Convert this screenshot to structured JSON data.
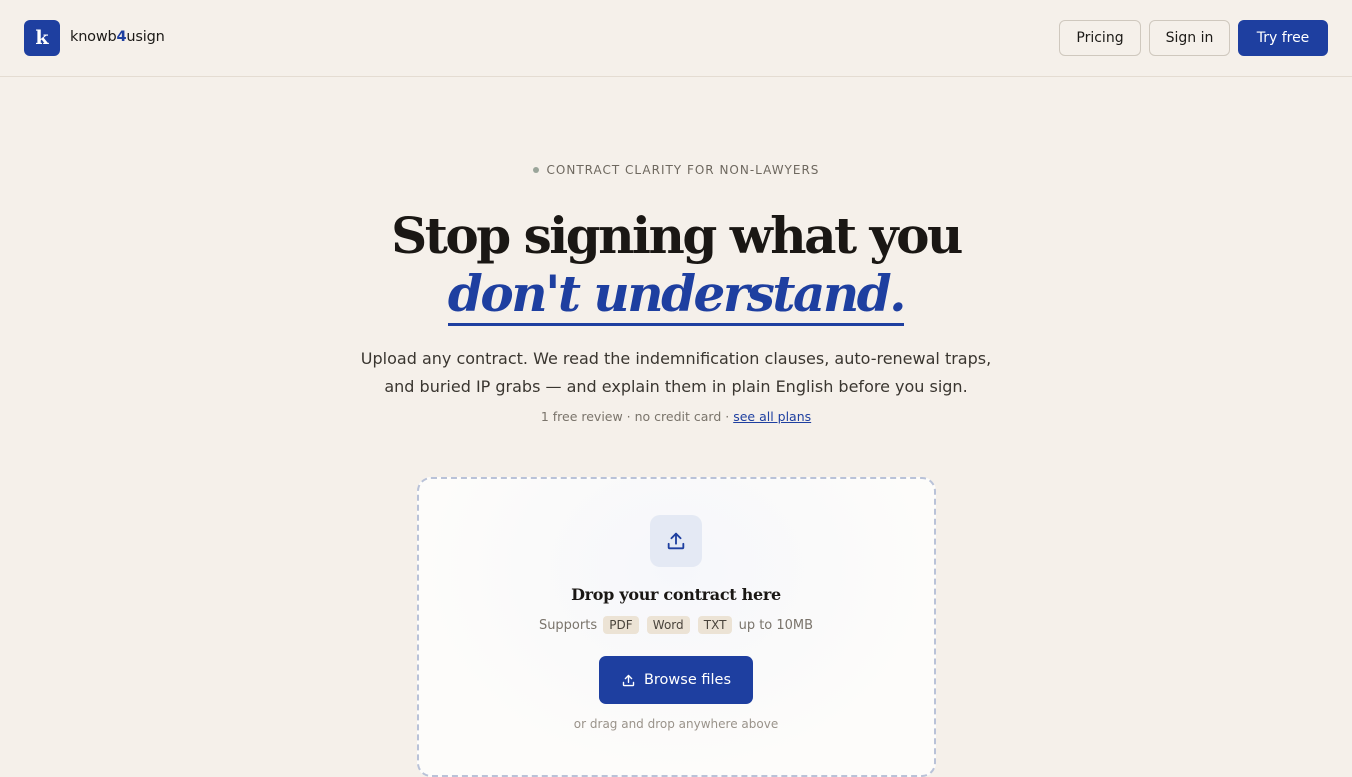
{
  "header": {
    "logo_letter": "k",
    "brand_pre": "knowb",
    "brand_accent": "4",
    "brand_post": "usign",
    "nav": {
      "pricing": "Pricing",
      "sign_in": "Sign in",
      "try_free": "Try free"
    }
  },
  "hero": {
    "eyebrow": "CONTRACT CLARITY FOR NON-LAWYERS",
    "headline_line1": "Stop signing what you",
    "headline_line2": "don't understand.",
    "subtitle": "Upload any contract. We read the indemnification clauses, auto-renewal traps, and buried IP grabs — and explain them in plain English before you sign.",
    "fine_print": "1 free review · no credit card · ",
    "plans_link": "see all plans"
  },
  "dropzone": {
    "icon": "upload-icon",
    "title": "Drop your contract here",
    "supports_label": "Supports",
    "formats": [
      "PDF",
      "Word",
      "TXT"
    ],
    "size_limit": "up to 10MB",
    "browse_label": "Browse files",
    "drag_note": "or drag and drop anywhere above"
  },
  "colors": {
    "accent": "#1e3fa0",
    "background": "#f5f0ea",
    "chip": "#ece3d5"
  }
}
